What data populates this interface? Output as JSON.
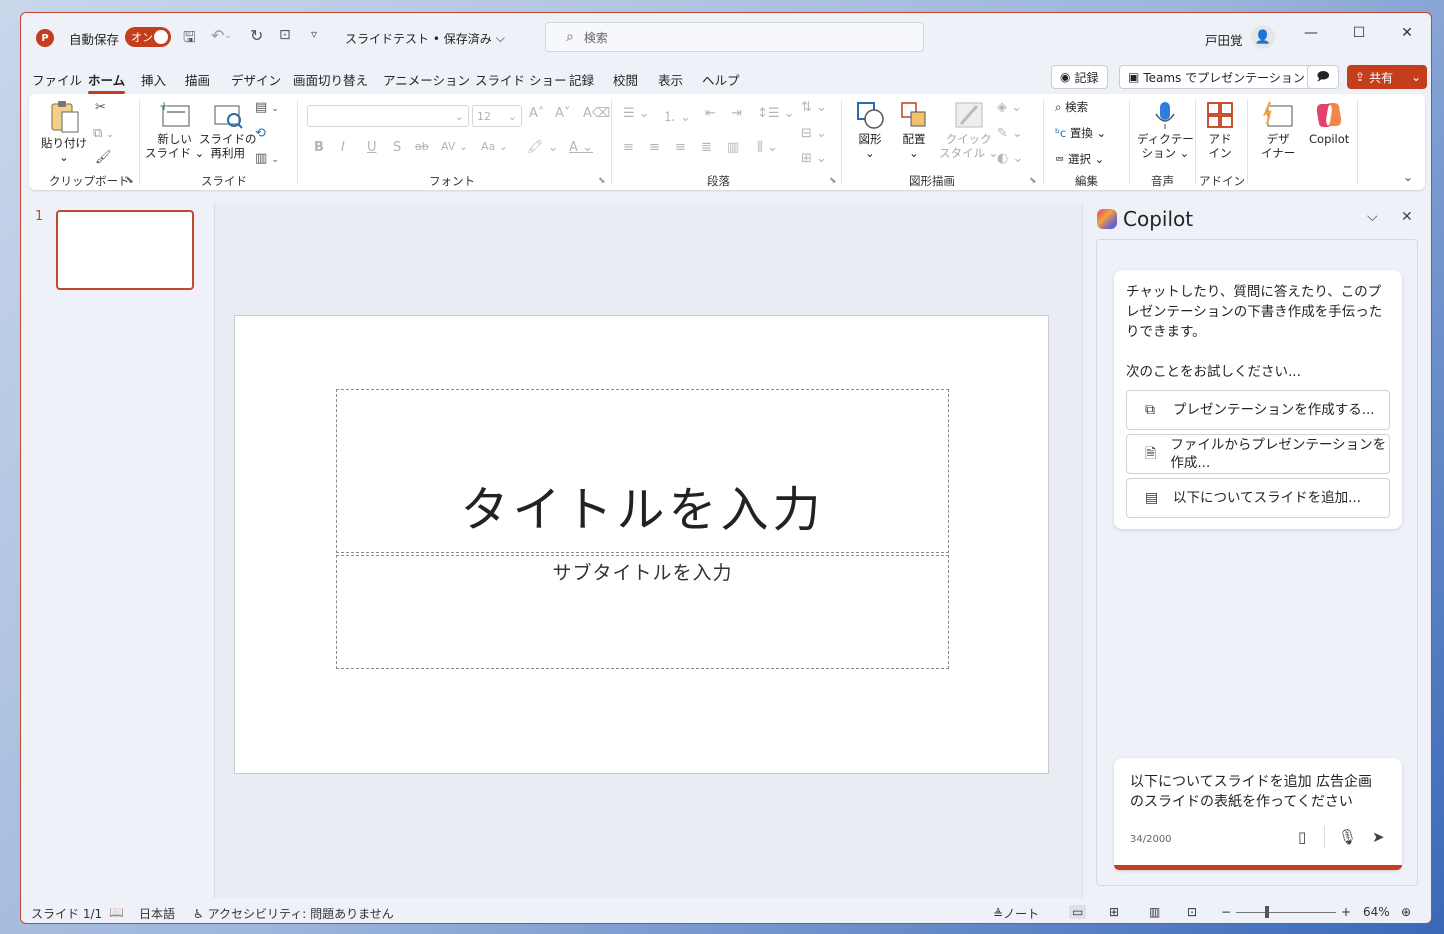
{
  "colors": {
    "accent": "#c43e1c",
    "window_bg": "#eef1f7"
  },
  "titlebar": {
    "autosave_label": "自動保存",
    "autosave_state": "オン",
    "doc_title": "スライドテスト • 保存済み",
    "search_placeholder": "検索",
    "user_name": "戸田覚"
  },
  "tabs": [
    "ファイル",
    "ホーム",
    "挿入",
    "描画",
    "デザイン",
    "画面切り替え",
    "アニメーション",
    "スライド ショー",
    "記録",
    "校閲",
    "表示",
    "ヘルプ"
  ],
  "actions": {
    "record": "記録",
    "teams": "Teams でプレゼンテーション",
    "share": "共有"
  },
  "ribbon": {
    "paste": "貼り付け",
    "new_slide_1": "新しい",
    "new_slide_2": "スライド",
    "reuse_1": "スライドの",
    "reuse_2": "再利用",
    "font_size": "12",
    "shapes": "図形",
    "arrange": "配置",
    "quick_style_1": "クイック",
    "quick_style_2": "スタイル",
    "find": "検索",
    "replace": "置換",
    "select": "選択",
    "dictate_1": "ディクテー",
    "dictate_2": "ション",
    "addin_1": "アド",
    "addin_2": "イン",
    "designer_1": "デザ",
    "designer_2": "イナー",
    "copilot": "Copilot",
    "groups": {
      "clipboard": "クリップボード",
      "slides": "スライド",
      "font": "フォント",
      "paragraph": "段落",
      "drawing": "図形描画",
      "editing": "編集",
      "voice": "音声",
      "addins": "アドイン"
    }
  },
  "thumbnail": {
    "number": "1"
  },
  "slide": {
    "title": "タイトルを入力",
    "subtitle": "サブタイトルを入力"
  },
  "copilot": {
    "title": "Copilot",
    "intro": "チャットしたり、質問に答えたり、このプレゼンテーションの下書き作成を手伝ったりできます。",
    "try_label": "次のことをお試しください...",
    "suggestions": [
      "プレゼンテーションを作成する...",
      "ファイルからプレゼンテーションを作成...",
      "以下についてスライドを追加..."
    ],
    "input_text": "以下についてスライドを追加 広告企画のスライドの表紙を作ってください",
    "char_count": "34/2000"
  },
  "status": {
    "slide_count": "スライド 1/1",
    "language": "日本語",
    "accessibility": "アクセシビリティ: 問題ありません",
    "notes": "ノート",
    "zoom": "64%"
  }
}
